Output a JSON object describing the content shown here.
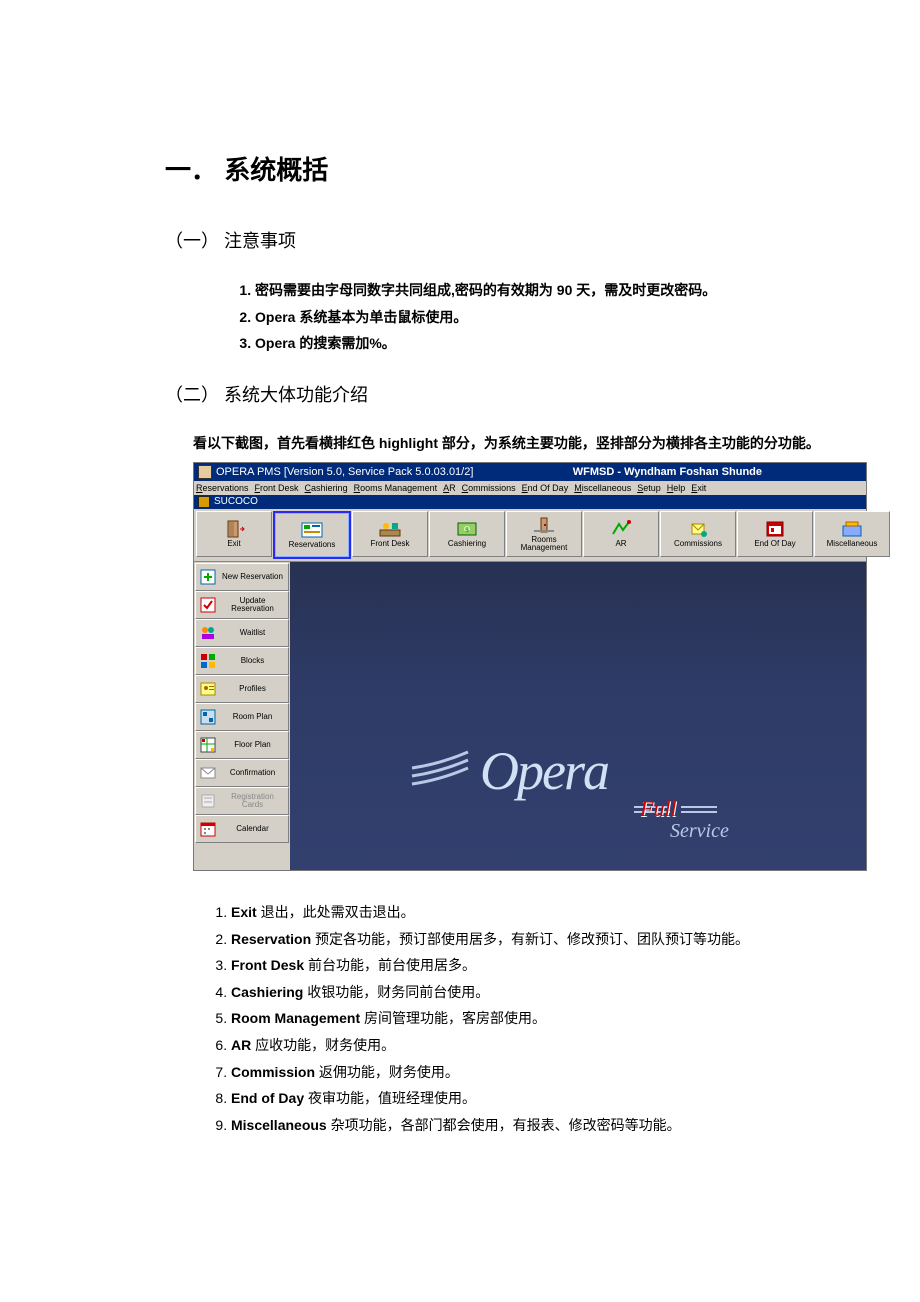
{
  "h1": "一．   系统概括",
  "section1": {
    "heading": "（一） 注意事项",
    "items": [
      "密码需要由字母同数字共同组成,密码的有效期为 90 天，需及时更改密码。",
      "Opera 系统基本为单击鼠标使用。",
      "Opera 的搜索需加%。"
    ]
  },
  "section2": {
    "heading": "（二） 系统大体功能介绍",
    "intro": "看以下截图，首先看横排红色 highlight 部分，为系统主要功能，竖排部分为横排各主功能的分功能。"
  },
  "screenshot": {
    "title": "OPERA PMS [Version 5.0, Service Pack 5.0.03.01/2]",
    "property": "WFMSD - Wyndham Foshan Shunde",
    "menu": [
      "Reservations",
      "Front Desk",
      "Cashiering",
      "Rooms Management",
      "AR",
      "Commissions",
      "End Of Day",
      "Miscellaneous",
      "Setup",
      "Help",
      "Exit"
    ],
    "child_title": "SUCOCO",
    "toolbar": [
      {
        "label": "Exit",
        "icon": "door"
      },
      {
        "label": "Reservations",
        "icon": "reserve",
        "selected": true
      },
      {
        "label": "Front Desk",
        "icon": "frontdesk"
      },
      {
        "label": "Cashiering",
        "icon": "cash"
      },
      {
        "label": "Rooms Management",
        "icon": "rooms"
      },
      {
        "label": "AR",
        "icon": "ar"
      },
      {
        "label": "Commissions",
        "icon": "comm"
      },
      {
        "label": "End Of Day",
        "icon": "eod"
      },
      {
        "label": "Miscellaneous",
        "icon": "misc"
      }
    ],
    "sidebar": [
      {
        "label": "New Reservation",
        "icon": "newres"
      },
      {
        "label": "Update Reservation",
        "icon": "updres"
      },
      {
        "label": "Waitlist",
        "icon": "wait"
      },
      {
        "label": "Blocks",
        "icon": "blocks"
      },
      {
        "label": "Profiles",
        "icon": "profiles"
      },
      {
        "label": "Room Plan",
        "icon": "roomplan"
      },
      {
        "label": "Floor Plan",
        "icon": "floorplan"
      },
      {
        "label": "Confirmation",
        "icon": "confirm"
      },
      {
        "label": "Registration Cards",
        "icon": "regcards",
        "disabled": true
      },
      {
        "label": "Calendar",
        "icon": "calendar"
      }
    ],
    "logo_main": "Opera",
    "logo_sub1": "Full",
    "logo_sub2": "Service"
  },
  "explain": [
    {
      "term": "Exit",
      "desc": "  退出，此处需双击退出。"
    },
    {
      "term": "Reservation",
      "desc": "  预定各功能，预订部使用居多，有新订、修改预订、团队预订等功能。"
    },
    {
      "term": "Front Desk",
      "desc": "  前台功能，前台使用居多。"
    },
    {
      "term": "Cashiering",
      "desc": "  收银功能，财务同前台使用。"
    },
    {
      "term": "Room Management",
      "desc": "  房间管理功能，客房部使用。"
    },
    {
      "term": "AR",
      "desc": "  应收功能，财务使用。"
    },
    {
      "term": "Commission",
      "desc": "  返佣功能，财务使用。"
    },
    {
      "term": "End of Day",
      "desc": "  夜审功能，值班经理使用。"
    },
    {
      "term": "Miscellaneous",
      "desc": "  杂项功能，各部门都会使用，有报表、修改密码等功能。"
    }
  ]
}
